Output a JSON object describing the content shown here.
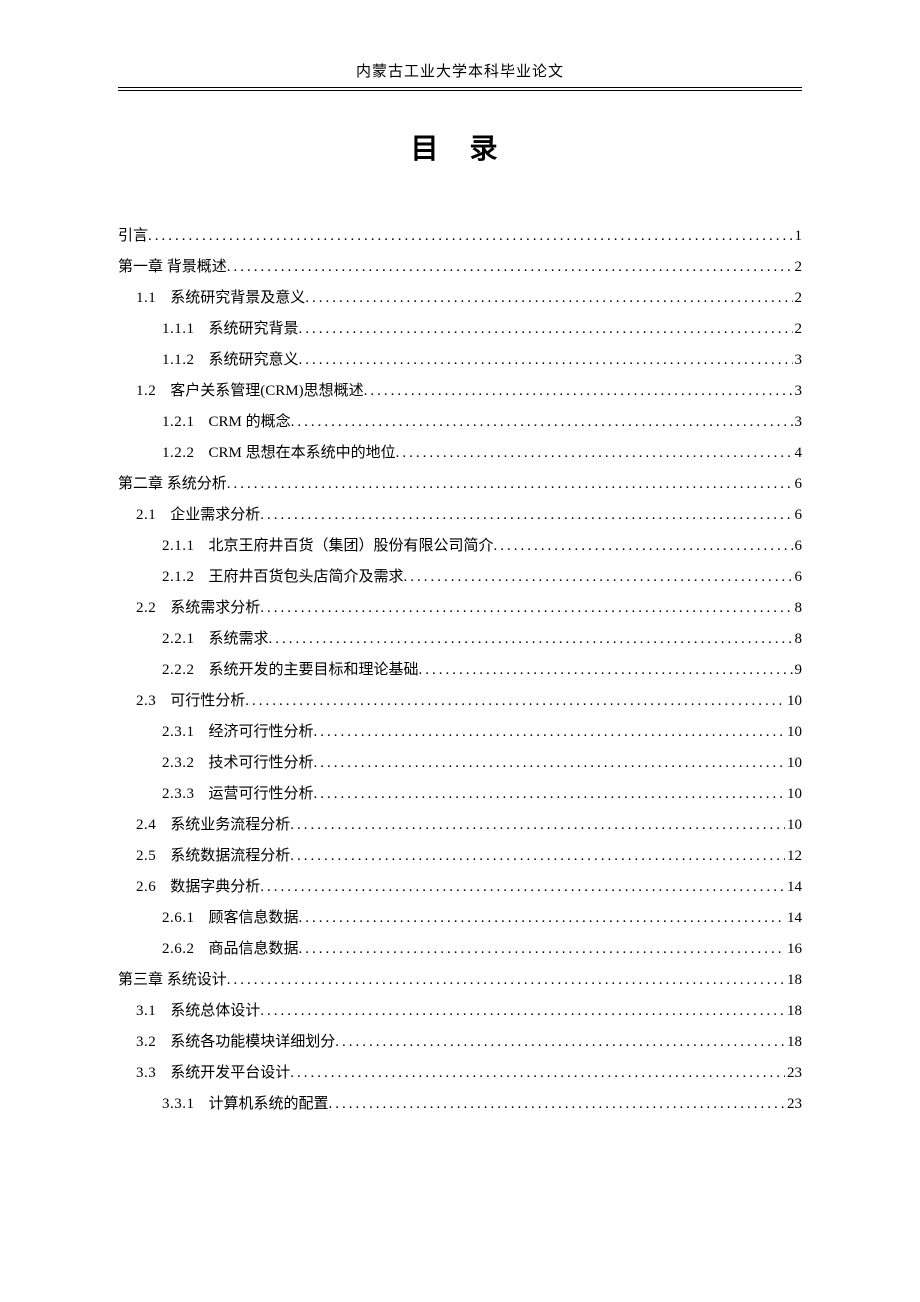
{
  "header": "内蒙古工业大学本科毕业论文",
  "title": "目  录",
  "toc": [
    {
      "lvl": 1,
      "num": "",
      "label": "引言",
      "page": "1"
    },
    {
      "lvl": 1,
      "num": "",
      "label": "第一章 背景概述",
      "page": "2"
    },
    {
      "lvl": 2,
      "num": "1.1",
      "label": "系统研究背景及意义",
      "page": "2"
    },
    {
      "lvl": 3,
      "num": "1.1.1",
      "label": "系统研究背景",
      "page": "2"
    },
    {
      "lvl": 3,
      "num": "1.1.2",
      "label": "系统研究意义",
      "page": "3"
    },
    {
      "lvl": 2,
      "num": "1.2",
      "label": "客户关系管理(CRM)思想概述",
      "page": "3"
    },
    {
      "lvl": 3,
      "num": "1.2.1",
      "label": "CRM 的概念 ",
      "page": "3"
    },
    {
      "lvl": 3,
      "num": "1.2.2",
      "label": "CRM 思想在本系统中的地位 ",
      "page": "4"
    },
    {
      "lvl": 1,
      "num": "",
      "label": "第二章 系统分析",
      "page": "6"
    },
    {
      "lvl": 2,
      "num": "2.1",
      "label": "企业需求分析",
      "page": "6"
    },
    {
      "lvl": 3,
      "num": "2.1.1",
      "label": "北京王府井百货（集团）股份有限公司简介",
      "page": "6"
    },
    {
      "lvl": 3,
      "num": "2.1.2",
      "label": "王府井百货包头店简介及需求",
      "page": "6"
    },
    {
      "lvl": 2,
      "num": "2.2",
      "label": "系统需求分析",
      "page": "8"
    },
    {
      "lvl": 3,
      "num": "2.2.1",
      "label": "系统需求",
      "page": "8"
    },
    {
      "lvl": 3,
      "num": "2.2.2",
      "label": "系统开发的主要目标和理论基础",
      "page": "9"
    },
    {
      "lvl": 2,
      "num": "2.3",
      "label": "可行性分析",
      "page": "10"
    },
    {
      "lvl": 3,
      "num": "2.3.1",
      "label": "经济可行性分析",
      "page": "10"
    },
    {
      "lvl": 3,
      "num": "2.3.2",
      "label": "技术可行性分析",
      "page": "10"
    },
    {
      "lvl": 3,
      "num": "2.3.3",
      "label": "运营可行性分析",
      "page": "10"
    },
    {
      "lvl": 2,
      "num": "2.4",
      "label": "系统业务流程分析",
      "page": "10"
    },
    {
      "lvl": 2,
      "num": "2.5",
      "label": "系统数据流程分析",
      "page": "12"
    },
    {
      "lvl": 2,
      "num": "2.6",
      "label": "数据字典分析",
      "page": "14"
    },
    {
      "lvl": 3,
      "num": "2.6.1",
      "label": "顾客信息数据",
      "page": "14"
    },
    {
      "lvl": 3,
      "num": "2.6.2",
      "label": "商品信息数据",
      "page": "16"
    },
    {
      "lvl": 1,
      "num": "",
      "label": "第三章 系统设计",
      "page": "18"
    },
    {
      "lvl": 2,
      "num": "3.1",
      "label": "系统总体设计",
      "page": "18"
    },
    {
      "lvl": 2,
      "num": "3.2",
      "label": "系统各功能模块详细划分",
      "page": "18"
    },
    {
      "lvl": 2,
      "num": "3.3",
      "label": "系统开发平台设计",
      "page": "23"
    },
    {
      "lvl": 3,
      "num": "3.3.1",
      "label": "计算机系统的配置",
      "page": "23"
    }
  ]
}
